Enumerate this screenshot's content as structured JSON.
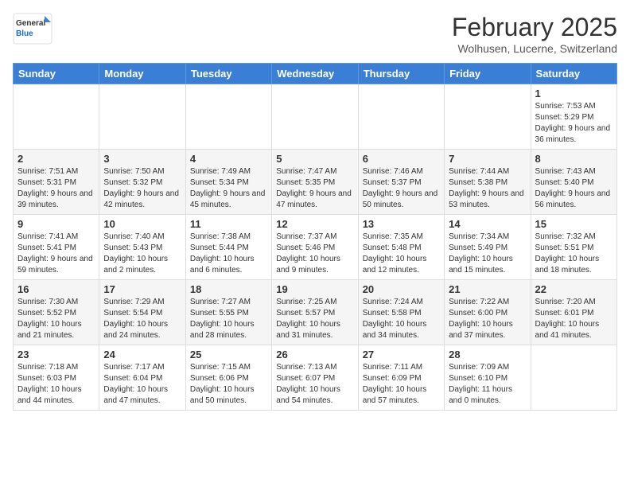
{
  "header": {
    "logo_general": "General",
    "logo_blue": "Blue",
    "month_year": "February 2025",
    "location": "Wolhusen, Lucerne, Switzerland"
  },
  "weekdays": [
    "Sunday",
    "Monday",
    "Tuesday",
    "Wednesday",
    "Thursday",
    "Friday",
    "Saturday"
  ],
  "weeks": [
    [
      {
        "day": "",
        "info": ""
      },
      {
        "day": "",
        "info": ""
      },
      {
        "day": "",
        "info": ""
      },
      {
        "day": "",
        "info": ""
      },
      {
        "day": "",
        "info": ""
      },
      {
        "day": "",
        "info": ""
      },
      {
        "day": "1",
        "info": "Sunrise: 7:53 AM\nSunset: 5:29 PM\nDaylight: 9 hours and 36 minutes."
      }
    ],
    [
      {
        "day": "2",
        "info": "Sunrise: 7:51 AM\nSunset: 5:31 PM\nDaylight: 9 hours and 39 minutes."
      },
      {
        "day": "3",
        "info": "Sunrise: 7:50 AM\nSunset: 5:32 PM\nDaylight: 9 hours and 42 minutes."
      },
      {
        "day": "4",
        "info": "Sunrise: 7:49 AM\nSunset: 5:34 PM\nDaylight: 9 hours and 45 minutes."
      },
      {
        "day": "5",
        "info": "Sunrise: 7:47 AM\nSunset: 5:35 PM\nDaylight: 9 hours and 47 minutes."
      },
      {
        "day": "6",
        "info": "Sunrise: 7:46 AM\nSunset: 5:37 PM\nDaylight: 9 hours and 50 minutes."
      },
      {
        "day": "7",
        "info": "Sunrise: 7:44 AM\nSunset: 5:38 PM\nDaylight: 9 hours and 53 minutes."
      },
      {
        "day": "8",
        "info": "Sunrise: 7:43 AM\nSunset: 5:40 PM\nDaylight: 9 hours and 56 minutes."
      }
    ],
    [
      {
        "day": "9",
        "info": "Sunrise: 7:41 AM\nSunset: 5:41 PM\nDaylight: 9 hours and 59 minutes."
      },
      {
        "day": "10",
        "info": "Sunrise: 7:40 AM\nSunset: 5:43 PM\nDaylight: 10 hours and 2 minutes."
      },
      {
        "day": "11",
        "info": "Sunrise: 7:38 AM\nSunset: 5:44 PM\nDaylight: 10 hours and 6 minutes."
      },
      {
        "day": "12",
        "info": "Sunrise: 7:37 AM\nSunset: 5:46 PM\nDaylight: 10 hours and 9 minutes."
      },
      {
        "day": "13",
        "info": "Sunrise: 7:35 AM\nSunset: 5:48 PM\nDaylight: 10 hours and 12 minutes."
      },
      {
        "day": "14",
        "info": "Sunrise: 7:34 AM\nSunset: 5:49 PM\nDaylight: 10 hours and 15 minutes."
      },
      {
        "day": "15",
        "info": "Sunrise: 7:32 AM\nSunset: 5:51 PM\nDaylight: 10 hours and 18 minutes."
      }
    ],
    [
      {
        "day": "16",
        "info": "Sunrise: 7:30 AM\nSunset: 5:52 PM\nDaylight: 10 hours and 21 minutes."
      },
      {
        "day": "17",
        "info": "Sunrise: 7:29 AM\nSunset: 5:54 PM\nDaylight: 10 hours and 24 minutes."
      },
      {
        "day": "18",
        "info": "Sunrise: 7:27 AM\nSunset: 5:55 PM\nDaylight: 10 hours and 28 minutes."
      },
      {
        "day": "19",
        "info": "Sunrise: 7:25 AM\nSunset: 5:57 PM\nDaylight: 10 hours and 31 minutes."
      },
      {
        "day": "20",
        "info": "Sunrise: 7:24 AM\nSunset: 5:58 PM\nDaylight: 10 hours and 34 minutes."
      },
      {
        "day": "21",
        "info": "Sunrise: 7:22 AM\nSunset: 6:00 PM\nDaylight: 10 hours and 37 minutes."
      },
      {
        "day": "22",
        "info": "Sunrise: 7:20 AM\nSunset: 6:01 PM\nDaylight: 10 hours and 41 minutes."
      }
    ],
    [
      {
        "day": "23",
        "info": "Sunrise: 7:18 AM\nSunset: 6:03 PM\nDaylight: 10 hours and 44 minutes."
      },
      {
        "day": "24",
        "info": "Sunrise: 7:17 AM\nSunset: 6:04 PM\nDaylight: 10 hours and 47 minutes."
      },
      {
        "day": "25",
        "info": "Sunrise: 7:15 AM\nSunset: 6:06 PM\nDaylight: 10 hours and 50 minutes."
      },
      {
        "day": "26",
        "info": "Sunrise: 7:13 AM\nSunset: 6:07 PM\nDaylight: 10 hours and 54 minutes."
      },
      {
        "day": "27",
        "info": "Sunrise: 7:11 AM\nSunset: 6:09 PM\nDaylight: 10 hours and 57 minutes."
      },
      {
        "day": "28",
        "info": "Sunrise: 7:09 AM\nSunset: 6:10 PM\nDaylight: 11 hours and 0 minutes."
      },
      {
        "day": "",
        "info": ""
      }
    ]
  ]
}
